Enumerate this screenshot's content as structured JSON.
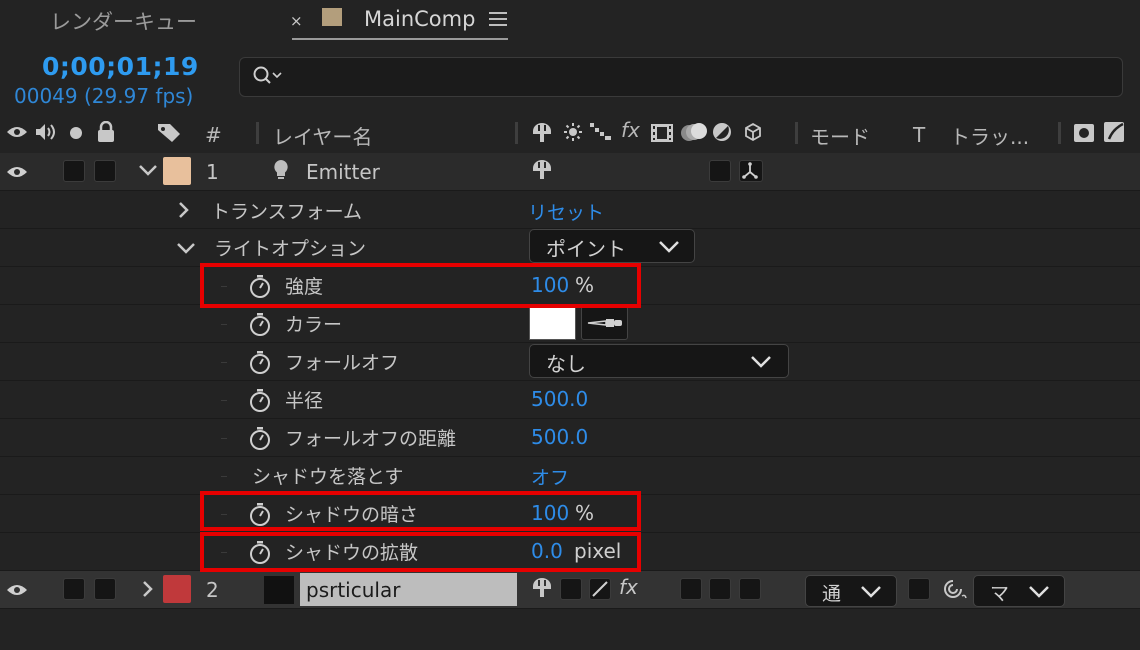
{
  "tabs": {
    "render_queue": "レンダーキュー",
    "close": "×",
    "main_comp": "MainComp"
  },
  "timecode": {
    "time": "0;00;01;19",
    "frames": "00049 (29.97 fps)"
  },
  "search": {
    "placeholder": ""
  },
  "header": {
    "hash": "#",
    "layer_name": "レイヤー名",
    "fx": "fx",
    "mode": "モード",
    "t": "T",
    "track": "トラッ..."
  },
  "layer1": {
    "index": "1",
    "name": "Emitter",
    "color": "#e8c09c"
  },
  "props": {
    "transform": {
      "label": "トランスフォーム",
      "value": "リセット"
    },
    "light_options": {
      "label": "ライトオプション",
      "value": "ポイント"
    },
    "intensity": {
      "label": "強度",
      "value": "100",
      "unit": "%"
    },
    "color": {
      "label": "カラー"
    },
    "falloff": {
      "label": "フォールオフ",
      "value": "なし"
    },
    "radius": {
      "label": "半径",
      "value": "500.0"
    },
    "falloff_distance": {
      "label": "フォールオフの距離",
      "value": "500.0"
    },
    "casts_shadows": {
      "label": "シャドウを落とす",
      "value": "オフ"
    },
    "shadow_darkness": {
      "label": "シャドウの暗さ",
      "value": "100",
      "unit": "%"
    },
    "shadow_diffusion": {
      "label": "シャドウの拡散",
      "value": "0.0",
      "unit": "pixel"
    }
  },
  "layer2": {
    "index": "2",
    "name": "psrticular",
    "color": "#c0393b",
    "fx": "fx",
    "mode": "通",
    "track": "マ"
  },
  "colors": {
    "accent_blue": "#2e8ce8",
    "highlight_red": "#e60000"
  }
}
